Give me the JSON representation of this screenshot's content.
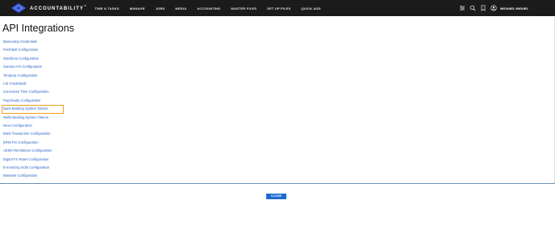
{
  "app": {
    "brand_name": "ACCOUNTABILITY",
    "brand_tm": "™",
    "brand_color": "#3d5fe0"
  },
  "nav": {
    "items": [
      {
        "label": "TIME & TASKS"
      },
      {
        "label": "MANAGE"
      },
      {
        "label": "JOBS"
      },
      {
        "label": "MEDIA"
      },
      {
        "label": "ACCOUNTING"
      },
      {
        "label": "MASTER FILES"
      },
      {
        "label": "SET UP FILES"
      },
      {
        "label": "QUICK ADD"
      }
    ]
  },
  "tools": {
    "icons": [
      "sliders-icon",
      "search-icon",
      "bookmark-icon",
      "user-circle-icon"
    ],
    "user_name": "MICHAEL MIGUEL"
  },
  "page": {
    "title": "API Integrations"
  },
  "links": [
    {
      "label": "Basecamp Credentials"
    },
    {
      "label": "Freshbell Configuration"
    },
    {
      "label": "Workfront Configuration"
    },
    {
      "label": "Sanaico HX Configuration"
    },
    {
      "label": "Tempora Configuration"
    },
    {
      "label": "LSI Credentials"
    },
    {
      "label": "Concourse Time Configuration"
    },
    {
      "label": "PayClearly Configuration"
    },
    {
      "label": "Bank Banking System Tokens",
      "selected": true
    },
    {
      "label": "Wells Banking System Tokens"
    },
    {
      "label": "Nexo Configuration"
    },
    {
      "label": "Bank Transaction Configuration"
    },
    {
      "label": "ERIS Pro Configuration"
    },
    {
      "label": "AEMX Remittance Configuration"
    },
    {
      "label": "Digital FX Rates Configuration"
    },
    {
      "label": "E-Invoicing India Configuration"
    },
    {
      "label": "Basware Configuration"
    }
  ],
  "footer": {
    "close_label": "CLOSE",
    "accent_color": "#1a6dd0",
    "selection_color": "#f0a020"
  }
}
